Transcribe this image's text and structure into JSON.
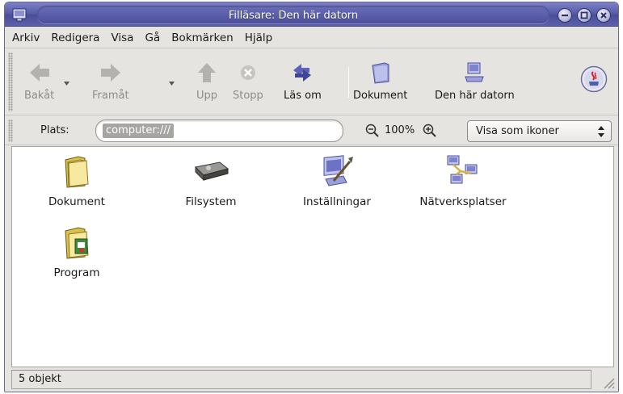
{
  "window": {
    "title": "Filläsare: Den här datorn",
    "buttons": [
      "minimize-icon",
      "maximize-icon",
      "close-icon"
    ]
  },
  "menubar": {
    "items": [
      "Arkiv",
      "Redigera",
      "Visa",
      "Gå",
      "Bokmärken",
      "Hjälp"
    ]
  },
  "toolbar": {
    "back": {
      "label": "Bakåt",
      "icon": "back-arrow-icon",
      "enabled": false
    },
    "forward": {
      "label": "Framåt",
      "icon": "forward-arrow-icon",
      "enabled": false
    },
    "up": {
      "label": "Upp",
      "icon": "up-arrow-icon",
      "enabled": false
    },
    "stop": {
      "label": "Stopp",
      "icon": "stop-icon",
      "enabled": false
    },
    "reload": {
      "label": "Läs om",
      "icon": "reload-icon",
      "enabled": true
    },
    "documents": {
      "label": "Dokument",
      "icon": "folder-icon",
      "enabled": true
    },
    "computer": {
      "label": "Den här datorn",
      "icon": "computer-icon",
      "enabled": true
    }
  },
  "location": {
    "label": "Plats:",
    "value": "computer:///",
    "zoom": "100%",
    "view_mode": "Visa som ikoner"
  },
  "items": [
    {
      "label": "Dokument",
      "icon": "folder-icon"
    },
    {
      "label": "Filsystem",
      "icon": "harddisk-icon"
    },
    {
      "label": "Inställningar",
      "icon": "settings-icon"
    },
    {
      "label": "Nätverksplatser",
      "icon": "network-icon"
    },
    {
      "label": "Program",
      "icon": "applications-folder-icon"
    }
  ],
  "status": {
    "text": "5 objekt"
  },
  "colors": {
    "titlebar": "#5a5ea8",
    "window_bg": "#e6e4e1",
    "content_bg": "#ffffff",
    "disabled_text": "#8e8c88"
  }
}
